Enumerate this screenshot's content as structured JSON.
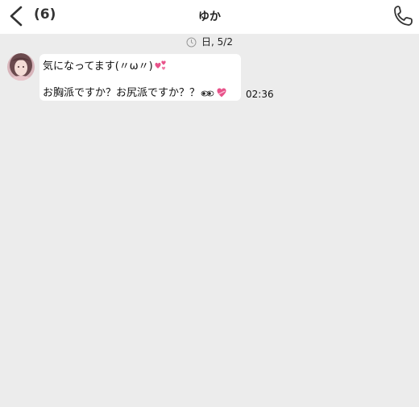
{
  "header": {
    "unread_count": "(6)",
    "title": "ゆか"
  },
  "date_divider": {
    "label": "日, 5/2"
  },
  "message": {
    "line1": "気になってます(〃ω〃)",
    "line2": "お胸派ですか？お尻派ですか？？",
    "time": "02:36",
    "line1_emoji": "two-hearts-icon",
    "line2_emojis": [
      "eyes-icon",
      "heart-with-ribbon-icon"
    ]
  },
  "colors": {
    "background": "#ececec",
    "header": "#ffffff",
    "bubble": "#ffffff",
    "heart_pink": "#e8528a"
  }
}
